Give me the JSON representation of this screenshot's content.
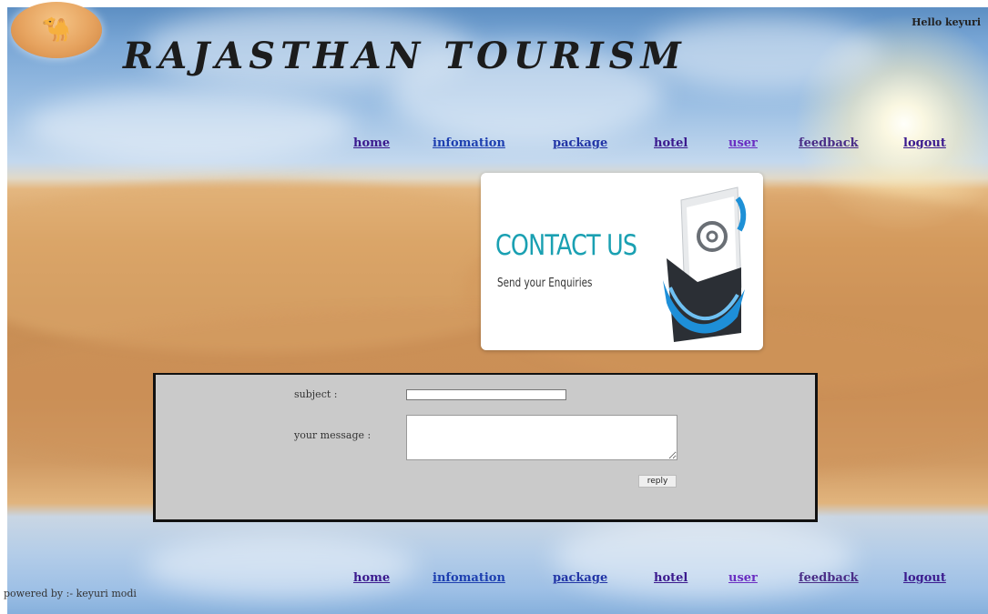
{
  "header": {
    "site_title": "RAJASTHAN TOURISM",
    "greeting": "Hello keyuri",
    "logo_icon": "camel-caravan-icon"
  },
  "nav_top": [
    {
      "id": "home",
      "label": "home"
    },
    {
      "id": "infomation",
      "label": "infomation"
    },
    {
      "id": "package",
      "label": "package"
    },
    {
      "id": "hotel",
      "label": "hotel"
    },
    {
      "id": "user",
      "label": "user"
    },
    {
      "id": "feedback",
      "label": "feedback"
    },
    {
      "id": "logout",
      "label": "logout"
    }
  ],
  "nav_bottom": [
    {
      "id": "home",
      "label": "home"
    },
    {
      "id": "infomation",
      "label": "infomation"
    },
    {
      "id": "package",
      "label": "package"
    },
    {
      "id": "hotel",
      "label": "hotel"
    },
    {
      "id": "user",
      "label": "user"
    },
    {
      "id": "feedback",
      "label": "feedback"
    },
    {
      "id": "logout",
      "label": "logout"
    }
  ],
  "banner": {
    "title": "CONTACT US",
    "subtitle": "Send your Enquiries",
    "icon": "email-envelope-icon"
  },
  "form": {
    "subject_label": "subject :",
    "subject_value": "",
    "message_label": "your message :",
    "message_value": "",
    "reply_label": "reply"
  },
  "footer": {
    "credit": "powered by :- keyuri modi"
  },
  "colors": {
    "nav_link": "#3b1a8e",
    "panel_bg": "#cacaca",
    "panel_border": "#111111",
    "banner_accent": "#1aa0b2"
  }
}
